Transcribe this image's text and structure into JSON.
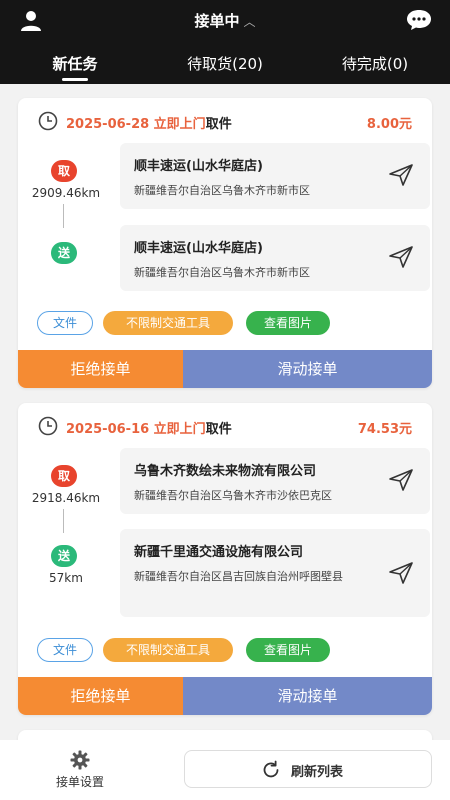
{
  "header": {
    "title": "接单中",
    "title_caret": "︿",
    "user_icon": "user-icon",
    "chat_icon": "chat-icon"
  },
  "tabs": [
    {
      "label": "新任务"
    },
    {
      "label": "待取货(20)"
    },
    {
      "label": "待完成(0)"
    }
  ],
  "orders": [
    {
      "date": "2025-06-28 立即上门",
      "pickup_word": "取件",
      "price": "8.00元",
      "pickup_badge": "取",
      "pickup_distance": "2909.46km",
      "pickup_name": "顺丰速运(山水华庭店)",
      "pickup_address": "新疆维吾尔自治区乌鲁木齐市新市区",
      "delivery_badge": "送",
      "delivery_distance": "",
      "delivery_name": "顺丰速运(山水华庭店)",
      "delivery_address": "新疆维吾尔自治区乌鲁木齐市新市区",
      "tag_file": "文件",
      "tag_vehicle": "不限制交通工具",
      "tag_photo": "查看图片",
      "reject_label": "拒绝接单",
      "accept_label": "滑动接单"
    },
    {
      "date": "2025-06-16 立即上门",
      "pickup_word": "取件",
      "price": "74.53元",
      "pickup_badge": "取",
      "pickup_distance": "2918.46km",
      "pickup_name": "乌鲁木齐数绘未来物流有限公司",
      "pickup_address": "新疆维吾尔自治区乌鲁木齐市沙依巴克区",
      "delivery_badge": "送",
      "delivery_distance": "57km",
      "delivery_name": "新疆千里通交通设施有限公司",
      "delivery_address": "新疆维吾尔自治区昌吉回族自治州呼图壁县",
      "tag_file": "文件",
      "tag_vehicle": "不限制交通工具",
      "tag_photo": "查看图片",
      "reject_label": "拒绝接单",
      "accept_label": "滑动接单"
    }
  ],
  "footer": {
    "settings_label": "接单设置",
    "refresh_label": "刷新列表"
  },
  "colors": {
    "accent_orange": "#e8623d",
    "reject_orange": "#f58b33",
    "accept_blue": "#7389c8",
    "photo_green": "#37b24d",
    "vehicle_amber": "#f4a93d",
    "header_dark": "#151515"
  }
}
